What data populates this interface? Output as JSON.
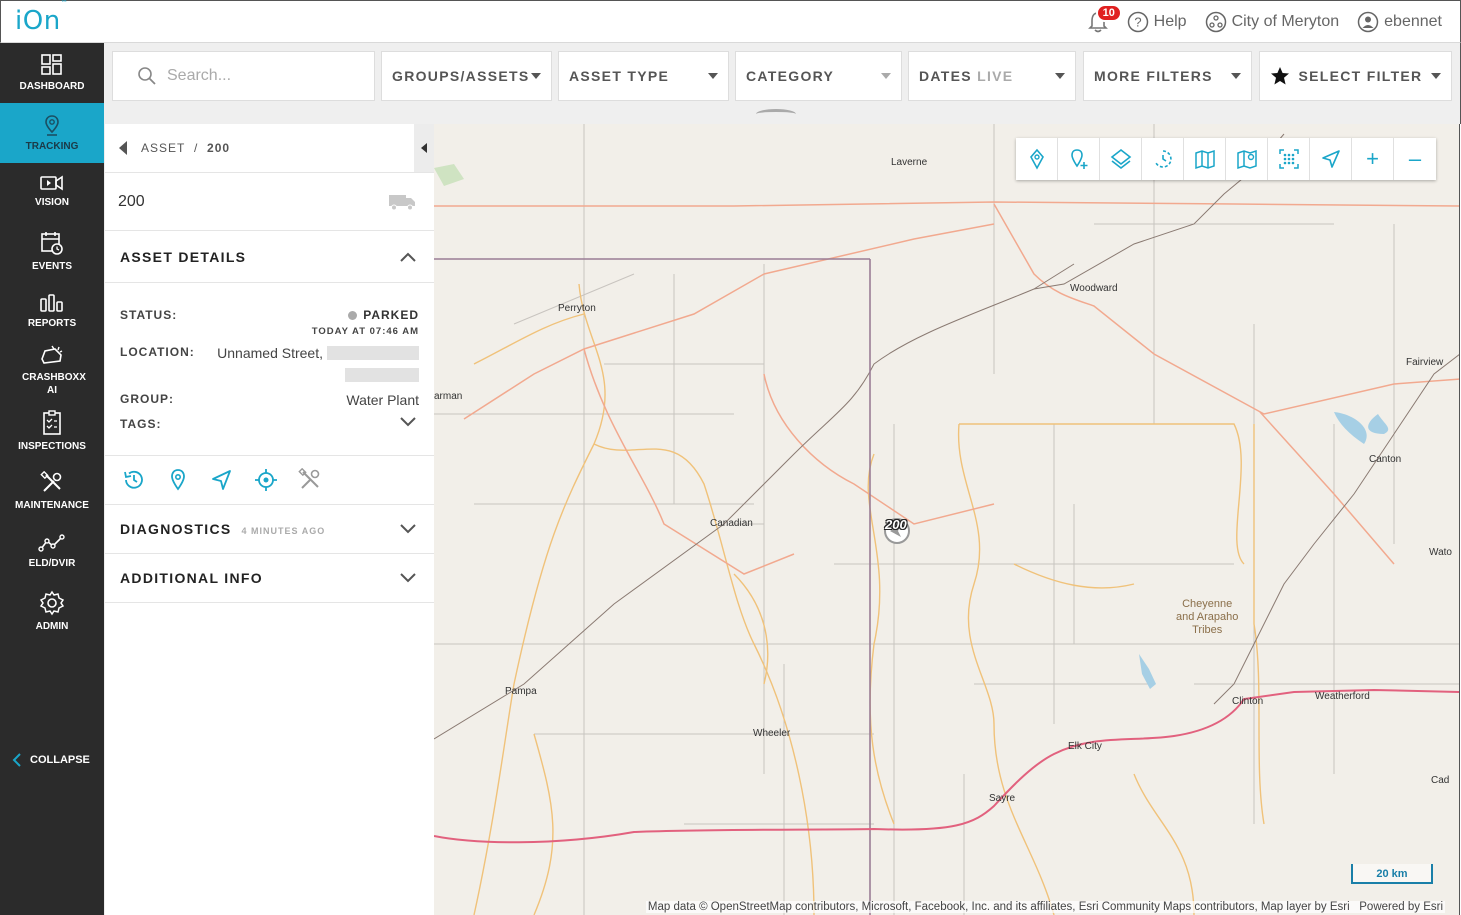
{
  "app": {
    "logo": "iOn",
    "logo_tm": "™",
    "notifications_count": "10",
    "help_label": "Help",
    "org_name": "City of Meryton",
    "username": "ebennet"
  },
  "sidebar": {
    "items": [
      {
        "label": "DASHBOARD",
        "icon": "dashboard-icon"
      },
      {
        "label": "TRACKING",
        "icon": "tracking-icon",
        "active": true
      },
      {
        "label": "VISION",
        "icon": "video-camera-icon"
      },
      {
        "label": "EVENTS",
        "icon": "calendar-clock-icon"
      },
      {
        "label": "REPORTS",
        "icon": "bar-chart-icon"
      },
      {
        "label": "CRASHBOXX AI",
        "icon": "crash-car-icon"
      },
      {
        "label": "INSPECTIONS",
        "icon": "checklist-icon"
      },
      {
        "label": "MAINTENANCE",
        "icon": "tools-icon"
      },
      {
        "label": "ELD/DVIR",
        "icon": "route-icon"
      },
      {
        "label": "ADMIN",
        "icon": "gear-icon"
      }
    ],
    "collapse_label": "COLLAPSE",
    "accent_color": "#1aa6c9"
  },
  "filters": {
    "search_placeholder": "Search...",
    "groups_assets": "GROUPS/ASSETS",
    "asset_type": "ASSET TYPE",
    "category": "CATEGORY",
    "dates": "DATES",
    "dates_live": "LIVE",
    "more_filters": "MORE FILTERS",
    "select_filter": "SELECT FILTER"
  },
  "panel": {
    "breadcrumb_root": "ASSET",
    "breadcrumb_sep": "/",
    "breadcrumb_current": "200",
    "asset_name": "200",
    "asset_details_title": "ASSET DETAILS",
    "status_label": "STATUS:",
    "status_value": "PARKED",
    "status_time": "TODAY AT 07:46 AM",
    "location_label": "LOCATION:",
    "location_value": "Unnamed Street,",
    "group_label": "GROUP:",
    "group_value": "Water Plant",
    "tags_label": "TAGS:",
    "diagnostics_title": "DIAGNOSTICS",
    "diagnostics_time": "4 MINUTES AGO",
    "additional_info_title": "ADDITIONAL INFO"
  },
  "map": {
    "places": [
      "Laverne",
      "Woodward",
      "Perryton",
      "Fairview",
      "arman",
      "Canton",
      "Canadian",
      "Wato",
      "Pampa",
      "Wheeler",
      "Clinton",
      "Weatherford",
      "Elk City",
      "Sayre",
      "Cad"
    ],
    "tribe": [
      "Cheyenne",
      "and Arapaho",
      "Tribes"
    ],
    "marker_label": "200",
    "scale_label": "20 km",
    "attribution": "Map data © OpenStreetMap contributors, Microsoft, Facebook, Inc. and its affiliates, Esri Community Maps contributors, Map layer by Esri",
    "powered_by": "Powered by Esri",
    "zoom_in": "+",
    "zoom_out": "–"
  }
}
